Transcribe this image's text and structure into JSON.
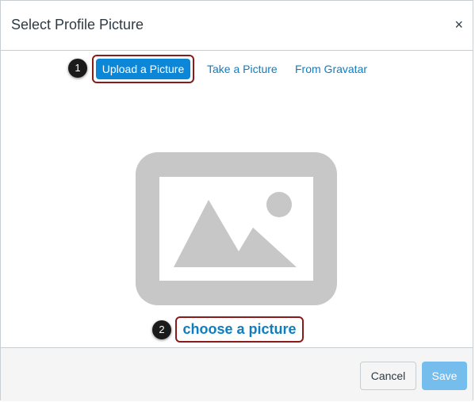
{
  "dialog": {
    "title": "Select Profile Picture",
    "close_glyph": "×"
  },
  "tabs": [
    {
      "label": "Upload a Picture",
      "active": true
    },
    {
      "label": "Take a Picture",
      "active": false
    },
    {
      "label": "From Gravatar",
      "active": false
    }
  ],
  "callouts": [
    "1",
    "2"
  ],
  "upload": {
    "placeholder_icon": "image-placeholder-icon",
    "choose_link": "choose a picture"
  },
  "footer": {
    "cancel_label": "Cancel",
    "save_label": "Save"
  },
  "colors": {
    "accent": "#0c86d6",
    "link": "#0e7dc2",
    "save_disabled": "#74bdec",
    "callout_border": "#8b1a1a",
    "placeholder_gray": "#c7c7c7"
  }
}
